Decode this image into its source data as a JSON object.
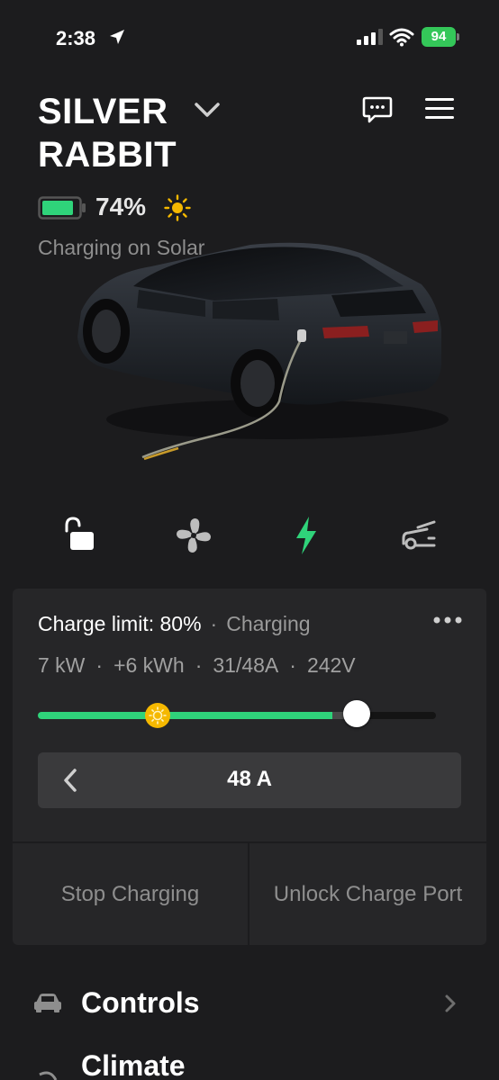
{
  "status_bar": {
    "time": "2:38",
    "battery": "94"
  },
  "header": {
    "car_name": "SILVER RABBIT",
    "battery_percent": "74%",
    "charge_status": "Charging on Solar"
  },
  "quick_controls": [
    {
      "icon": "unlocked-lock-icon",
      "active": false
    },
    {
      "icon": "fan-icon",
      "active": false
    },
    {
      "icon": "bolt-icon",
      "active": true
    },
    {
      "icon": "car-trunk-icon",
      "active": false
    }
  ],
  "charge_card": {
    "limit_label": "Charge limit: 80%",
    "state": "Charging",
    "stats": [
      "7 kW",
      "+6 kWh",
      "31/48A",
      "242V"
    ],
    "slider": {
      "charge_level": 0.74,
      "limit_level": 0.8,
      "solar_marker": 0.3
    },
    "amps_value": "48 A",
    "stop_button": "Stop Charging",
    "unlock_button": "Unlock Charge Port"
  },
  "menu": [
    {
      "label": "Controls"
    },
    {
      "label": "Climate"
    }
  ],
  "colors": {
    "accent_green": "#2fd37a",
    "solar_yellow": "#f5b800",
    "background": "#1c1c1e",
    "card": "#262628"
  }
}
